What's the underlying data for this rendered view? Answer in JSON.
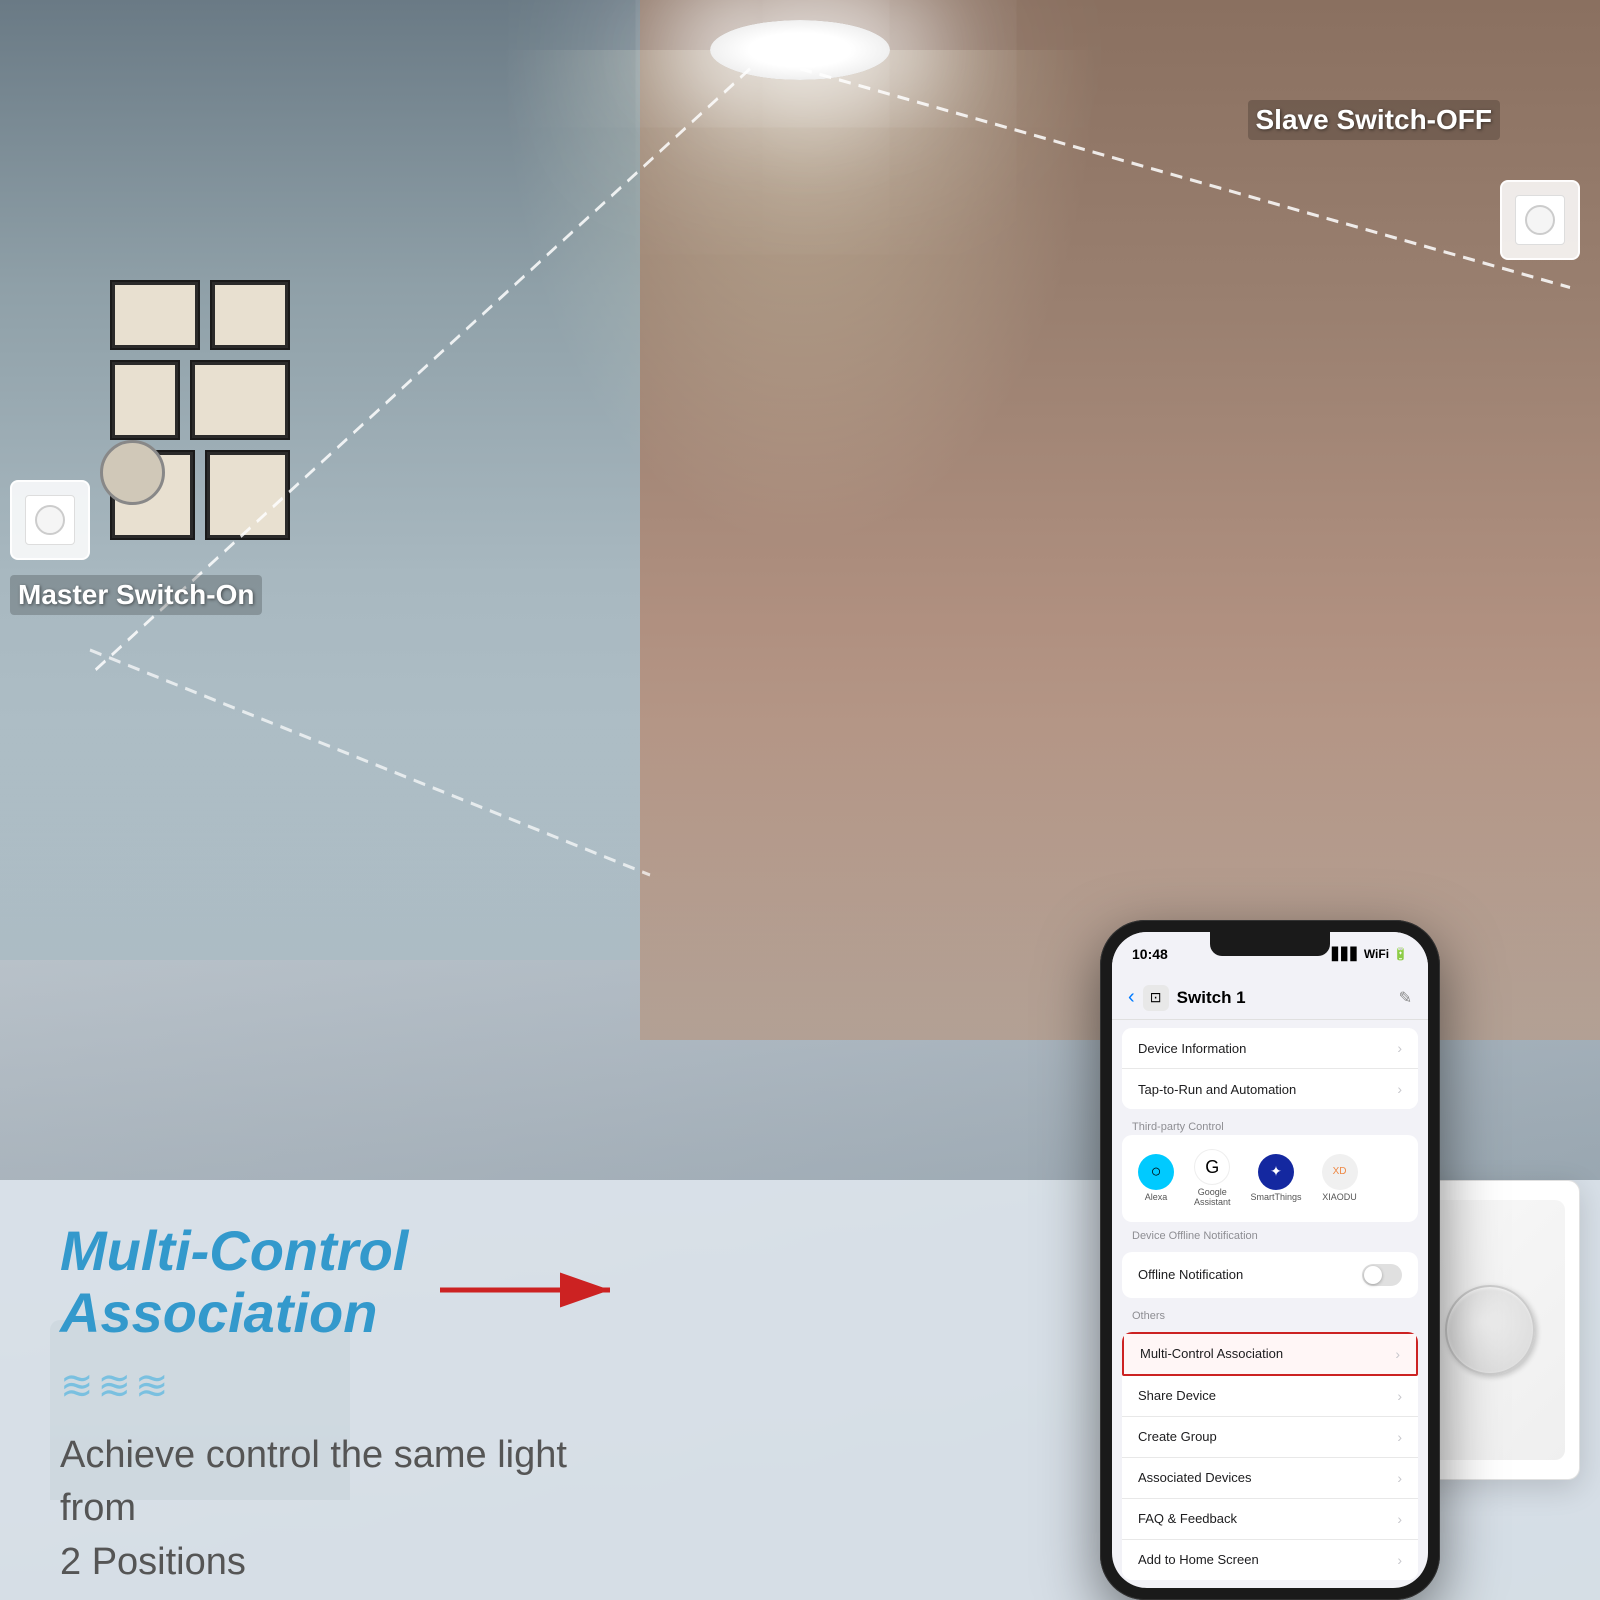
{
  "scene": {
    "master_switch_label": "Master Switch-On",
    "slave_switch_label": "Slave Switch-OFF",
    "ceiling_light_alt": "Ceiling Light"
  },
  "feature": {
    "title": "Multi-Control Association",
    "wave": "≋≋≋",
    "description_line1": "Achieve control the same light from",
    "description_line2": "2 Positions"
  },
  "phone": {
    "status_bar": {
      "time": "10:48",
      "signal": "▋▋▋",
      "wifi": "WiFi",
      "battery": "■"
    },
    "nav": {
      "back_icon": "‹",
      "device_icon": "⊡",
      "title": "Switch 1",
      "edit_icon": "✎"
    },
    "menu_items": [
      {
        "label": "Device Information",
        "has_arrow": true,
        "type": "normal"
      },
      {
        "label": "Tap-to-Run and Automation",
        "has_arrow": true,
        "type": "normal"
      }
    ],
    "section_third_party": "Third-party Control",
    "third_party_icons": [
      {
        "label": "Alexa",
        "color": "alexa"
      },
      {
        "label": "Google\nAssistant",
        "color": "google"
      },
      {
        "label": "SmartThings",
        "color": "smartthings"
      },
      {
        "label": "XIAODU",
        "color": "xiaodu"
      }
    ],
    "section_offline": "Device Offline Notification",
    "offline_label": "Offline Notification",
    "section_others": "Others",
    "others_menu": [
      {
        "label": "Multi-Control Association",
        "has_arrow": true,
        "type": "highlighted"
      },
      {
        "label": "Share Device",
        "has_arrow": true,
        "type": "normal"
      },
      {
        "label": "Create Group",
        "has_arrow": true,
        "type": "normal"
      },
      {
        "label": "Associated Devices",
        "has_arrow": true,
        "type": "normal"
      },
      {
        "label": "FAQ & Feedback",
        "has_arrow": true,
        "type": "normal"
      },
      {
        "label": "Add to Home Screen",
        "has_arrow": true,
        "type": "normal"
      }
    ]
  }
}
